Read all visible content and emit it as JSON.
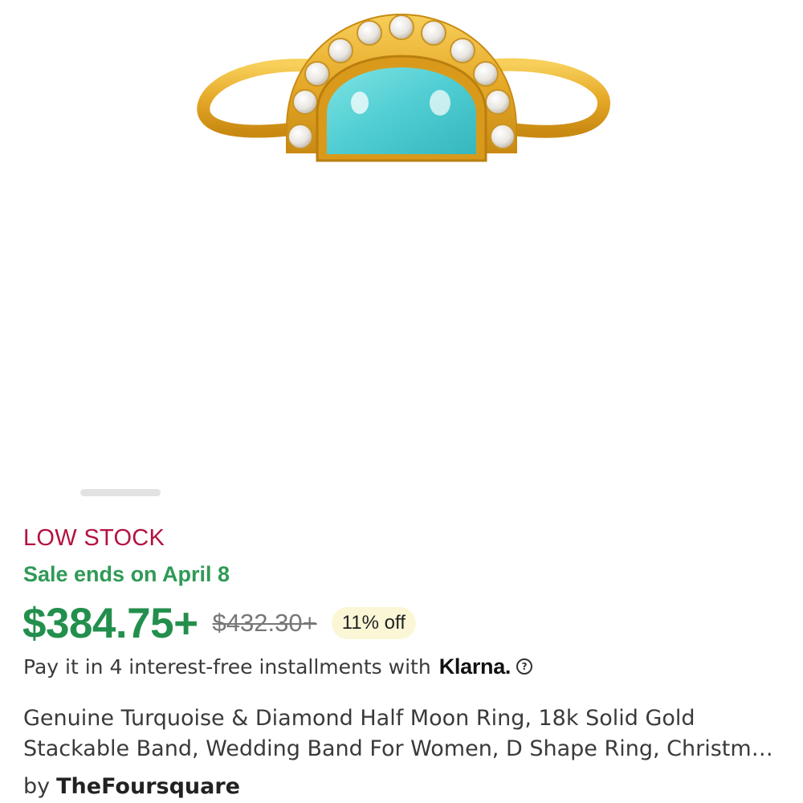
{
  "listing": {
    "stock_status": "LOW STOCK",
    "sale_text": "Sale ends on April 8",
    "price": "$384.75+",
    "original_price": "$432.30+",
    "discount": "11% off",
    "installment_text": "Pay it in 4 interest-free installments with",
    "klarna_brand": "Klarna.",
    "help_icon_glyph": "?",
    "title": "Genuine Turquoise & Diamond Half Moon Ring, 18k Solid Gold Stackable Band, Wedding Band For Women, D Shape Ring, Christmas Gift",
    "seller_prefix": "by",
    "seller_name": "TheFoursquare"
  },
  "gallery": {
    "image_subject": "turquoise-diamond-half-moon-gold-ring",
    "indicator_icon": "carousel-dots",
    "active_index": 1
  },
  "colors": {
    "stock_status": "#b3123f",
    "sale": "#2f9a56",
    "price": "#238f4d",
    "discount_badge": "#fbf7d6",
    "gold": "#e8b23a",
    "turquoise": "#5fd3d6"
  }
}
